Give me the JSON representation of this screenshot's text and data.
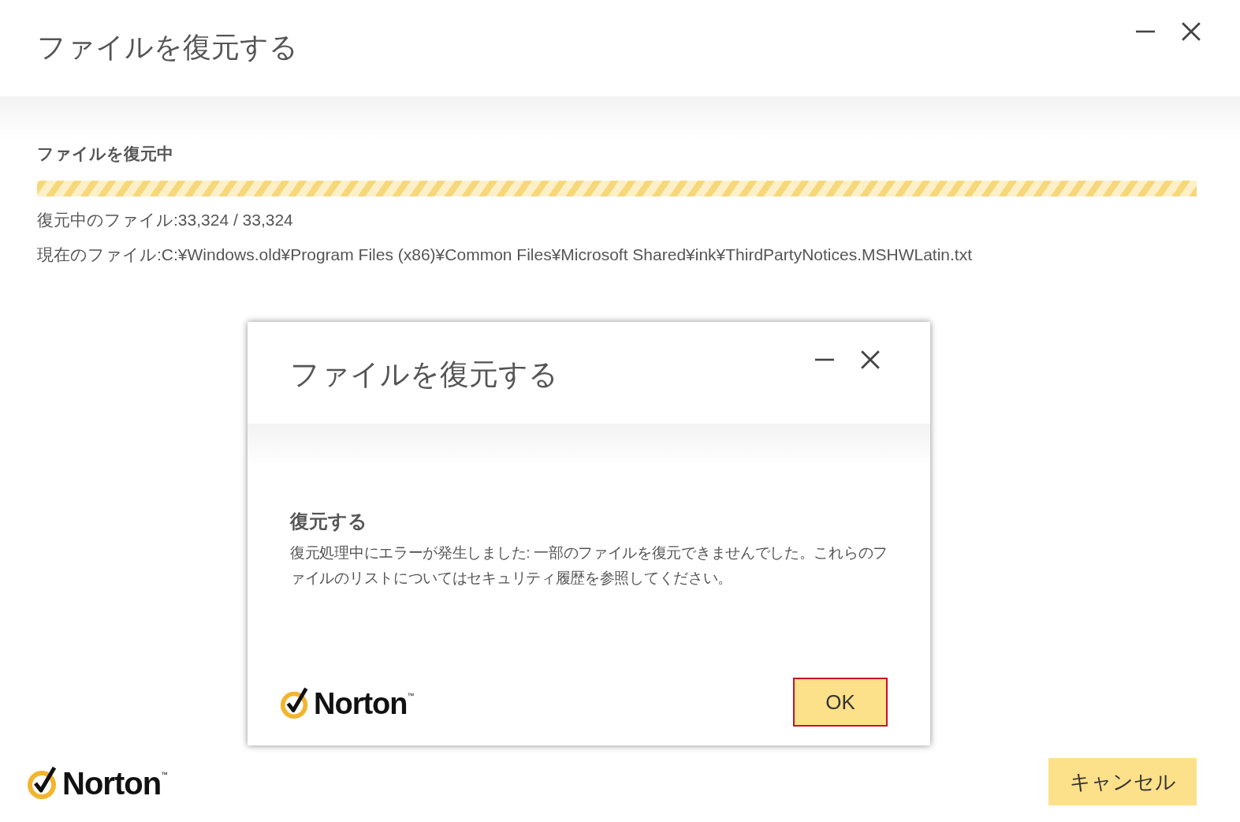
{
  "window": {
    "title": "ファイルを復元する",
    "controls": [
      {
        "kind": "minimize"
      },
      {
        "kind": "close"
      }
    ]
  },
  "progress": {
    "label": "ファイルを復元中",
    "level": 1,
    "count_text": "復元中のファイル:33,324 / 33,324",
    "current_file": "現在のファイル:C:¥Windows.old¥Program Files (x86)¥Common Files¥Microsoft Shared¥ink¥ThirdPartyNotices.MSHWLatin.txt"
  },
  "footer": {
    "logo": {
      "text": "Norton",
      "mark": "™"
    },
    "buttons": [
      {
        "label": "キャンセル",
        "focused": false
      }
    ]
  },
  "dialog": {
    "title": "ファイルを復元する",
    "controls": [
      {
        "kind": "minimize"
      },
      {
        "kind": "close"
      }
    ],
    "heading": "復元する",
    "message": "復元処理中にエラーが発生しました: 一部のファイルを復元できませんでした。これらのファイルのリストについてはセキュリティ履歴を参照してください。",
    "logo": {
      "text": "Norton",
      "mark": "™"
    },
    "buttons": [
      {
        "label": "OK",
        "focused": true
      }
    ]
  }
}
